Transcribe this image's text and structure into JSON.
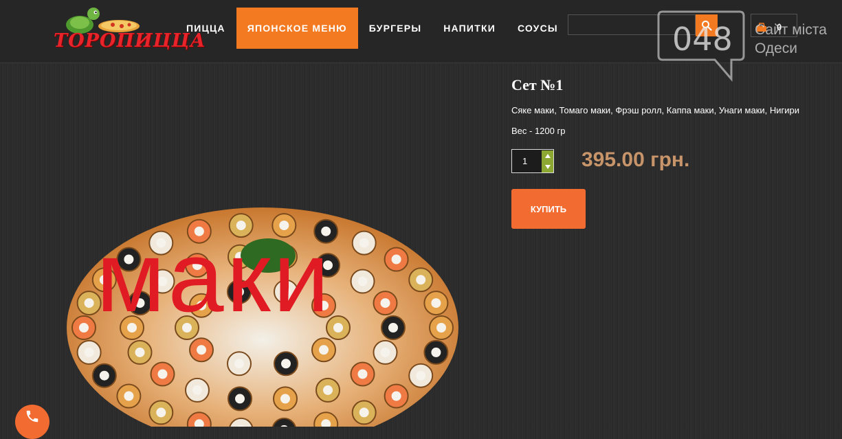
{
  "header": {
    "logo_text": "ТОРОПИЦЦА",
    "nav": [
      {
        "label": "ПИЦЦА"
      },
      {
        "label": "ЯПОНСКОЕ МЕНЮ"
      },
      {
        "label": "БУРГЕРЫ"
      },
      {
        "label": "НАПИТКИ"
      },
      {
        "label": "СОУСЫ"
      }
    ],
    "search": {
      "value": "",
      "placeholder": ""
    },
    "cart_count": "0"
  },
  "watermark": {
    "number": "048",
    "line1": "Сайт міста",
    "line2": "Одеси"
  },
  "product": {
    "title": "Сет №1",
    "description": "Сяке маки, Томаго маки, Фрэш ролл, Каппа маки, Унаги маки, Нигири",
    "weight": "Вес - 1200 гр",
    "quantity": "1",
    "price": "395.00 грн.",
    "buy_label": "КУПИТЬ",
    "image_caption": "маки"
  },
  "colors": {
    "accent": "#f47a22",
    "price": "#c8946a",
    "stepper": "#8da832",
    "caption": "#e11b23"
  },
  "icons": {
    "search": "search-icon",
    "cart": "cart-icon",
    "phone": "phone-icon"
  }
}
